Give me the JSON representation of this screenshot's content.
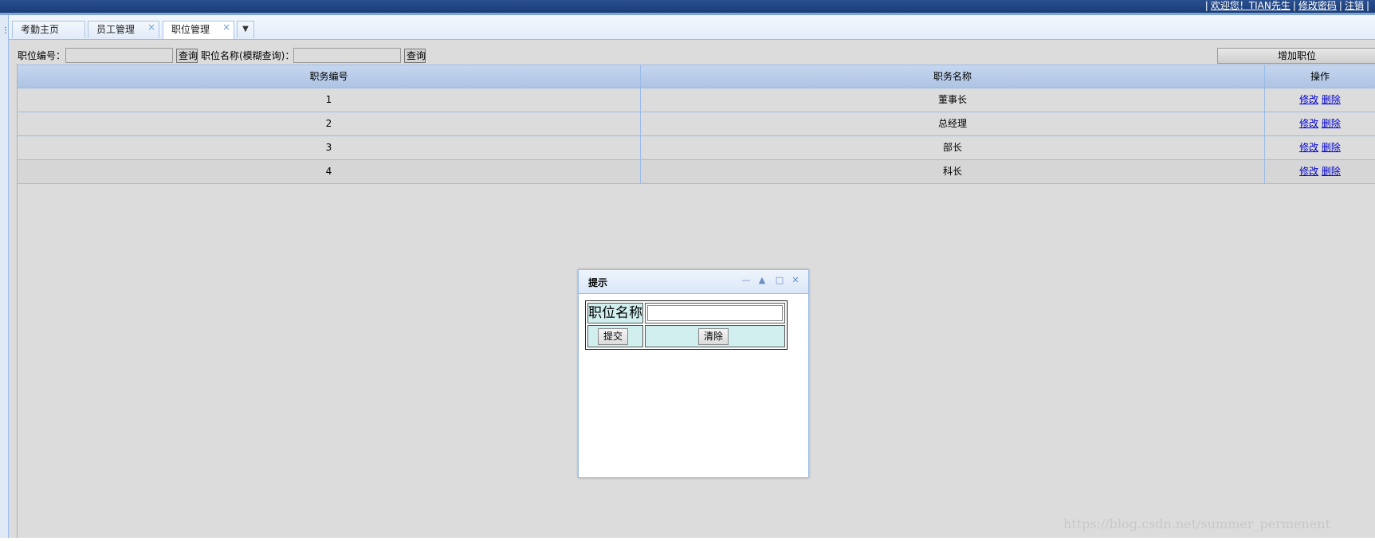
{
  "header": {
    "welcome": "欢迎您！TIAN先生",
    "change_password": "修改密码",
    "logout": "注销",
    "separator": "|"
  },
  "tabs": [
    {
      "label": "考勤主页",
      "closable": false
    },
    {
      "label": "员工管理",
      "closable": true
    },
    {
      "label": "职位管理",
      "closable": true,
      "active": true
    }
  ],
  "search": {
    "id_label": "职位编号：",
    "query_button": "查询",
    "name_label": "职位名称(模糊查询)：",
    "query_button2": "查询",
    "add_button": "增加职位"
  },
  "grid": {
    "columns": [
      "职务编号",
      "职务名称",
      "操作"
    ],
    "rows": [
      {
        "id": "1",
        "name": "董事长"
      },
      {
        "id": "2",
        "name": "总经理"
      },
      {
        "id": "3",
        "name": "部长"
      },
      {
        "id": "4",
        "name": "科长"
      }
    ],
    "edit_label": "修改",
    "delete_label": "删除"
  },
  "dialog": {
    "title": "提示",
    "field_label": "职位名称",
    "field_value": "",
    "submit_label": "提交",
    "clear_label": "清除"
  },
  "watermark": "https://blog.csdn.net/summer_permenent",
  "colors": {
    "header_bg": "#1b3d77",
    "content_bg": "#dcdcdc",
    "grid_header_bg": "#aec4e4",
    "form_cell_bg": "#d2efef",
    "link": "#0000cc"
  }
}
